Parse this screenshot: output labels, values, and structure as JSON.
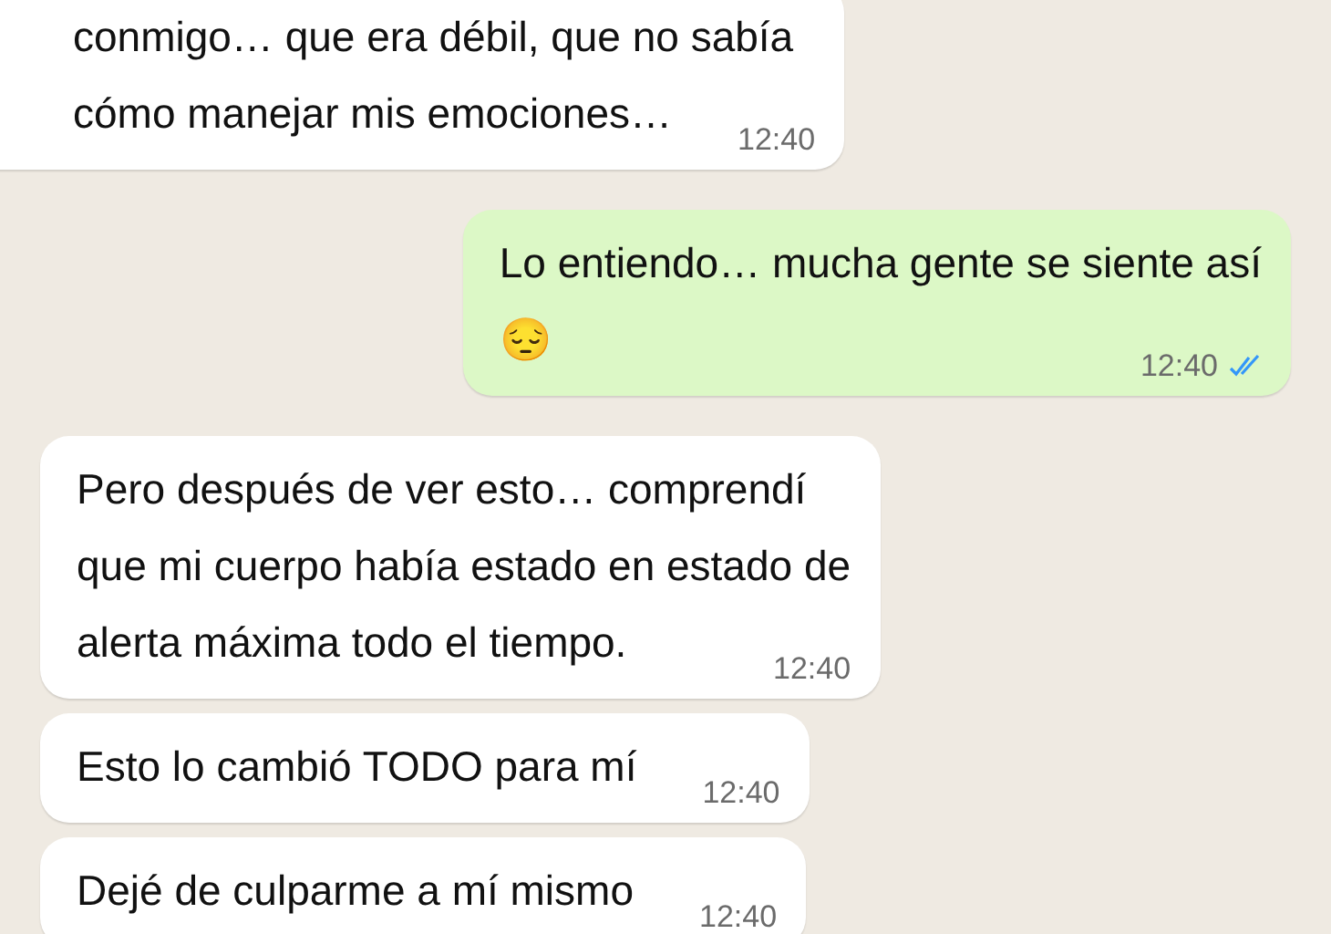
{
  "messages": [
    {
      "outgoing": false,
      "lines": [
        "conmigo… que era débil, que no sabía",
        "cómo manejar mis emociones…"
      ],
      "time": "12:40"
    },
    {
      "outgoing": true,
      "lines": [
        "Lo entiendo… mucha gente se siente así",
        "😔"
      ],
      "time": "12:40",
      "read": true
    },
    {
      "outgoing": false,
      "lines": [
        "Pero después de ver esto… comprendí",
        "que mi cuerpo había estado en estado de",
        "alerta máxima todo el tiempo."
      ],
      "time": "12:40"
    },
    {
      "outgoing": false,
      "lines": [
        "Esto lo cambió TODO para mí"
      ],
      "time": "12:40"
    },
    {
      "outgoing": false,
      "lines": [
        "Dejé de culparme a mí mismo"
      ],
      "time": "12:40"
    }
  ]
}
